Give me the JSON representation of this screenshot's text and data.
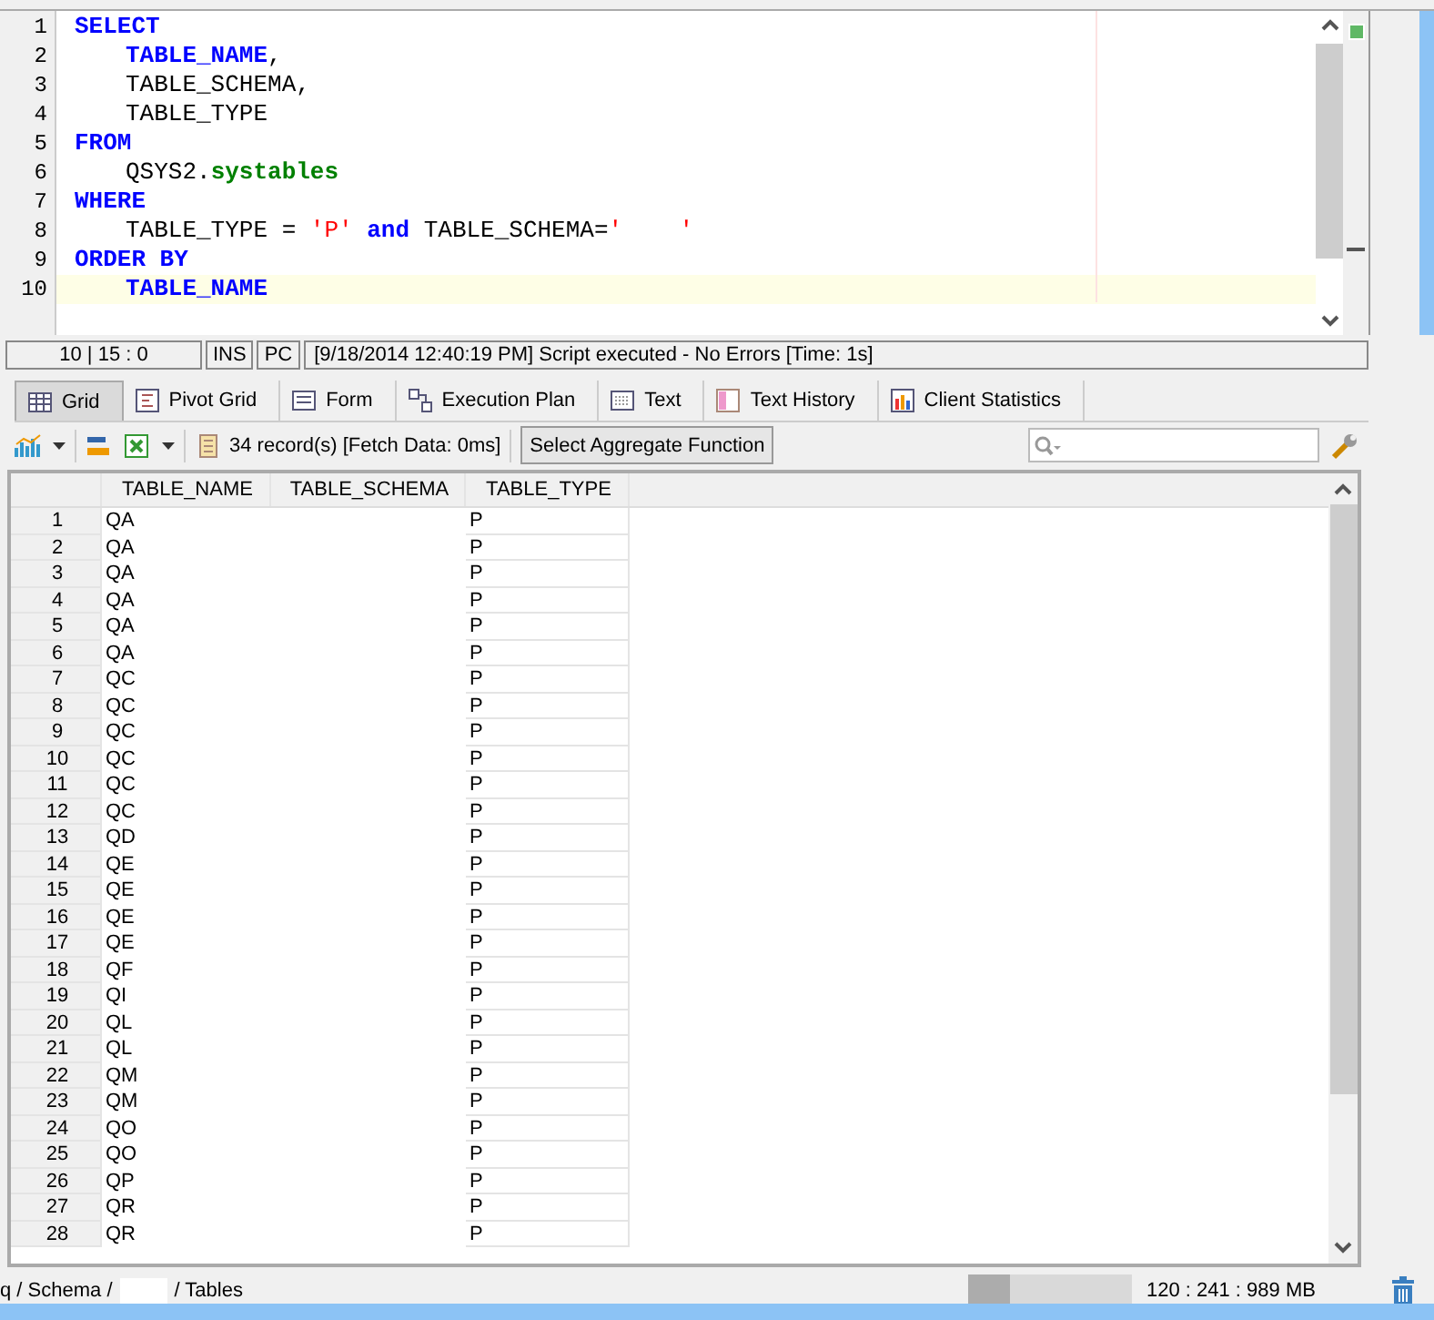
{
  "editor": {
    "lines": [
      {
        "number": "1",
        "indented": false,
        "current": false,
        "tokens": [
          {
            "text": "SELECT",
            "kind": "keyword"
          }
        ]
      },
      {
        "number": "2",
        "indented": true,
        "current": false,
        "tokens": [
          {
            "text": "TABLE_NAME",
            "kind": "keyword"
          },
          {
            "text": ",",
            "kind": "plain"
          }
        ]
      },
      {
        "number": "3",
        "indented": true,
        "current": false,
        "tokens": [
          {
            "text": "TABLE_SCHEMA,",
            "kind": "plain"
          }
        ]
      },
      {
        "number": "4",
        "indented": true,
        "current": false,
        "tokens": [
          {
            "text": "TABLE_TYPE",
            "kind": "plain"
          }
        ]
      },
      {
        "number": "5",
        "indented": false,
        "current": false,
        "tokens": [
          {
            "text": "FROM",
            "kind": "keyword"
          }
        ]
      },
      {
        "number": "6",
        "indented": true,
        "current": false,
        "tokens": [
          {
            "text": "QSYS2.",
            "kind": "plain"
          },
          {
            "text": "systables",
            "kind": "object"
          }
        ]
      },
      {
        "number": "7",
        "indented": false,
        "current": false,
        "tokens": [
          {
            "text": "WHERE",
            "kind": "keyword"
          }
        ]
      },
      {
        "number": "8",
        "indented": true,
        "current": false,
        "tokens": [
          {
            "text": "TABLE_TYPE = ",
            "kind": "plain"
          },
          {
            "text": "'P'",
            "kind": "string"
          },
          {
            "text": " and",
            "kind": "keyword"
          },
          {
            "text": " TABLE_SCHEMA=",
            "kind": "plain"
          },
          {
            "text": "'    '",
            "kind": "string"
          }
        ]
      },
      {
        "number": "9",
        "indented": false,
        "current": false,
        "tokens": [
          {
            "text": "ORDER BY",
            "kind": "keyword"
          }
        ]
      },
      {
        "number": "10",
        "indented": true,
        "current": true,
        "tokens": [
          {
            "text": "TABLE_NAME",
            "kind": "keyword"
          }
        ]
      }
    ]
  },
  "editor_status": {
    "position": "10 | 15 : 0",
    "mode": "INS",
    "line_ending": "PC",
    "message": "[9/18/2014 12:40:19 PM] Script executed - No Errors [Time: 1s]"
  },
  "tabs": [
    {
      "label": "Grid",
      "selected": true
    },
    {
      "label": "Pivot Grid",
      "selected": false
    },
    {
      "label": "Form",
      "selected": false
    },
    {
      "label": "Execution Plan",
      "selected": false
    },
    {
      "label": "Text",
      "selected": false
    },
    {
      "label": "Text History",
      "selected": false
    },
    {
      "label": "Client Statistics",
      "selected": false
    }
  ],
  "toolbar": {
    "records": "34 record(s) [Fetch Data: 0ms]",
    "aggregate_button": "Select Aggregate Function"
  },
  "table": {
    "columns": [
      "TABLE_NAME",
      "TABLE_SCHEMA",
      "TABLE_TYPE"
    ],
    "rows": [
      {
        "n": "1",
        "name": "QA",
        "type": "P"
      },
      {
        "n": "2",
        "name": "QA",
        "type": "P"
      },
      {
        "n": "3",
        "name": "QA",
        "type": "P"
      },
      {
        "n": "4",
        "name": "QA",
        "type": "P"
      },
      {
        "n": "5",
        "name": "QA",
        "type": "P"
      },
      {
        "n": "6",
        "name": "QA",
        "type": "P"
      },
      {
        "n": "7",
        "name": "QC",
        "type": "P"
      },
      {
        "n": "8",
        "name": "QC",
        "type": "P"
      },
      {
        "n": "9",
        "name": "QC",
        "type": "P"
      },
      {
        "n": "10",
        "name": "QC",
        "type": "P"
      },
      {
        "n": "11",
        "name": "QC",
        "type": "P"
      },
      {
        "n": "12",
        "name": "QC",
        "type": "P"
      },
      {
        "n": "13",
        "name": "QD",
        "type": "P"
      },
      {
        "n": "14",
        "name": "QE",
        "type": "P"
      },
      {
        "n": "15",
        "name": "QE",
        "type": "P"
      },
      {
        "n": "16",
        "name": "QE",
        "type": "P"
      },
      {
        "n": "17",
        "name": "QE",
        "type": "P"
      },
      {
        "n": "18",
        "name": "QF",
        "type": "P"
      },
      {
        "n": "19",
        "name": "QI",
        "type": "P"
      },
      {
        "n": "20",
        "name": "QL",
        "type": "P"
      },
      {
        "n": "21",
        "name": "QL",
        "type": "P"
      },
      {
        "n": "22",
        "name": "QM",
        "type": "P"
      },
      {
        "n": "23",
        "name": "QM",
        "type": "P"
      },
      {
        "n": "24",
        "name": "QO",
        "type": "P"
      },
      {
        "n": "25",
        "name": "QO",
        "type": "P"
      },
      {
        "n": "26",
        "name": "QP",
        "type": "P"
      },
      {
        "n": "27",
        "name": "QR",
        "type": "P"
      },
      {
        "n": "28",
        "name": "QR",
        "type": "P"
      }
    ]
  },
  "status_bar": {
    "path_start": "q / Schema /",
    "path_end": "/ Tables",
    "memory": "120 : 241 : 989 MB",
    "memory_bar": {
      "level": 0.25
    }
  }
}
